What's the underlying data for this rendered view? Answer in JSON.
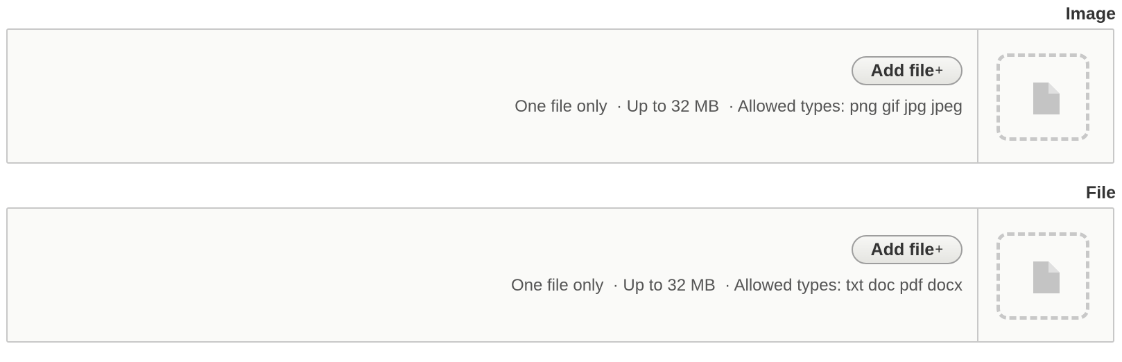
{
  "fields": [
    {
      "label": "Image",
      "button_label": "Add file",
      "button_plus": "+",
      "meta_count": "One file only",
      "meta_size": "Up to 32 MB",
      "meta_types": "Allowed types: png gif jpg jpeg",
      "separator": "·"
    },
    {
      "label": "File",
      "button_label": "Add file",
      "button_plus": "+",
      "meta_count": "One file only",
      "meta_size": "Up to 32 MB",
      "meta_types": "Allowed types: txt doc pdf docx",
      "separator": "·"
    }
  ],
  "icons": {
    "placeholder": "file-icon"
  },
  "colors": {
    "border": "#c8c8c8",
    "panel_bg": "#fafaf8",
    "icon_fill": "#c4c4c4"
  }
}
